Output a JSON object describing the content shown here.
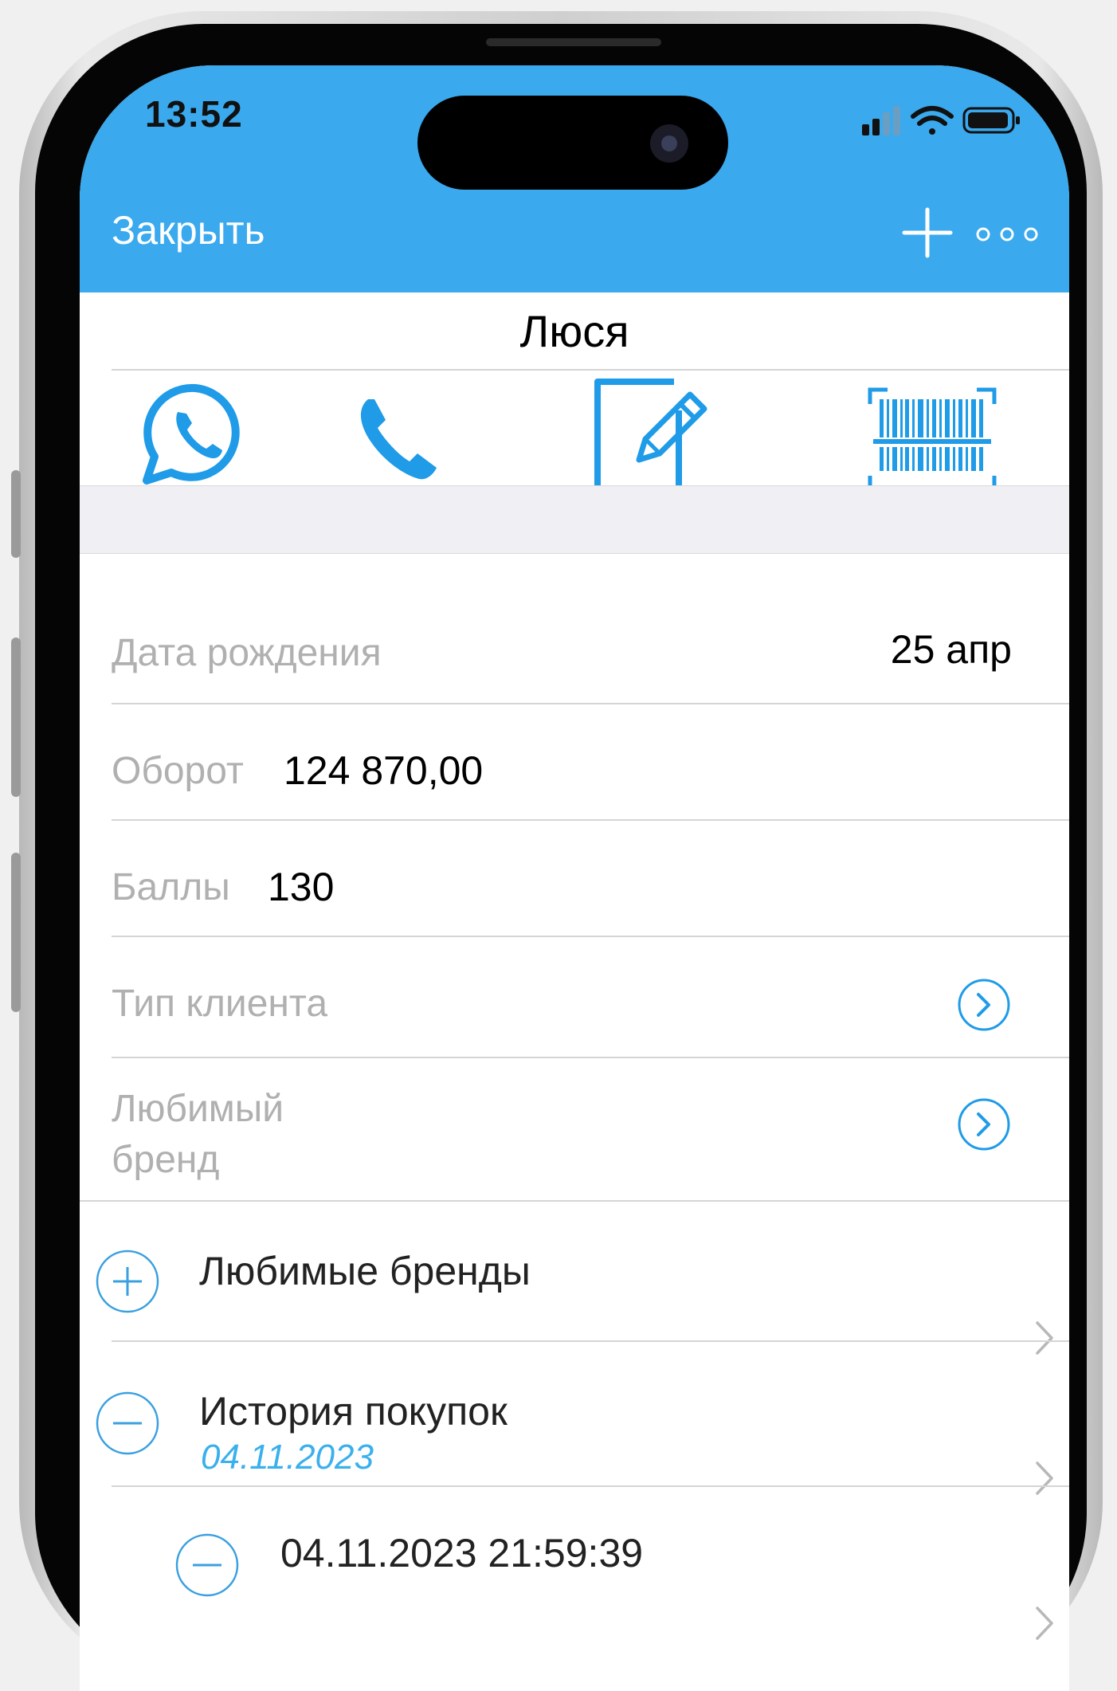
{
  "status_bar": {
    "time": "13:52"
  },
  "nav": {
    "close_label": "Закрыть"
  },
  "client": {
    "name": "Люся"
  },
  "actions": [
    {
      "icon": "whatsapp-icon"
    },
    {
      "icon": "phone-icon"
    },
    {
      "icon": "edit-note-icon"
    },
    {
      "icon": "barcode-scan-icon"
    }
  ],
  "fields": {
    "birthday": {
      "label": "Дата рождения",
      "value": "25 апр"
    },
    "turnover": {
      "label": "Оборот",
      "value": "124 870,00"
    },
    "points": {
      "label": "Баллы",
      "value": "130"
    },
    "client_type": {
      "label": "Тип клиента"
    },
    "favorite_brand": {
      "label_line1": "Любимый",
      "label_line2": "бренд"
    }
  },
  "sections": {
    "favorite_brands": {
      "title": "Любимые бренды"
    },
    "purchase_history": {
      "title": "История покупок",
      "subtitle": "04.11.2023"
    },
    "purchase_item": {
      "title": "04.11.2023 21:59:39"
    }
  },
  "colors": {
    "header_blue": "#3aa9ee",
    "icon_blue": "#1f9be8",
    "accent_text_blue": "#3ab0ec",
    "label_gray": "#b0b0b0"
  }
}
